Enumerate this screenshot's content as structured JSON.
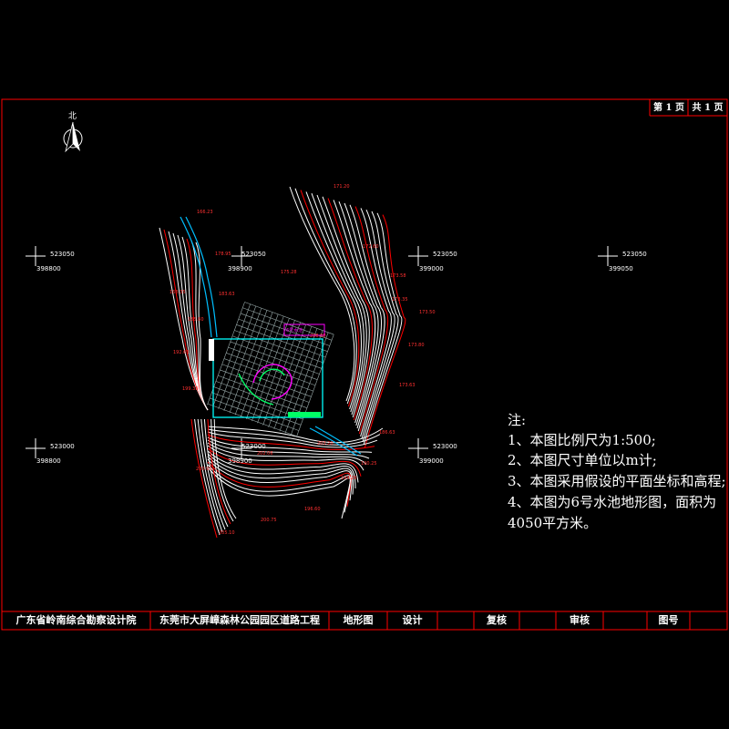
{
  "north_label": "北",
  "sheet": {
    "page_no": "第 1 页",
    "page_total": "共 1 页"
  },
  "title_block": {
    "company": "广东省岭南综合勘察设计院",
    "project": "东莞市大屏嶂森林公园园区道路工程",
    "drawing_name": "地形图",
    "design": "设计",
    "review": "复核",
    "check": "审核",
    "drawing_no": "图号"
  },
  "notes": {
    "heading": "注:",
    "items": [
      "1、本图比例尺为1:500;",
      "2、本图尺寸单位以m计;",
      "3、本图采用假设的平面坐标和高程;",
      "4、本图为6号水池地形图，面积为",
      "4050平方米。"
    ]
  },
  "grid_coords": [
    {
      "n": "523050",
      "e": "398800"
    },
    {
      "n": "523050",
      "e": "398900"
    },
    {
      "n": "523050",
      "e": "399000"
    },
    {
      "n": "523050",
      "e": "399050"
    },
    {
      "n": "523000",
      "e": "398800"
    },
    {
      "n": "523000",
      "e": "398900"
    },
    {
      "n": "523000",
      "e": "399000"
    }
  ],
  "elevations": [
    "171.20",
    "172.60",
    "173.58",
    "173.35",
    "173.50",
    "173.80",
    "173.63",
    "183.63",
    "185.60",
    "186.63",
    "190.25",
    "194.26",
    "196.60",
    "200.75",
    "205.10",
    "200.95",
    "202.06",
    "203.20",
    "192.63",
    "199.38",
    "208.00",
    "175.28",
    "178.95",
    "168.35",
    "166.23"
  ],
  "colors": {
    "frame": "#ff0000",
    "contour": "#ffffff",
    "index_contour": "#ff0000",
    "grid": "#00ffff",
    "stream": "#00bfff",
    "highlight": "#ff00ff"
  }
}
